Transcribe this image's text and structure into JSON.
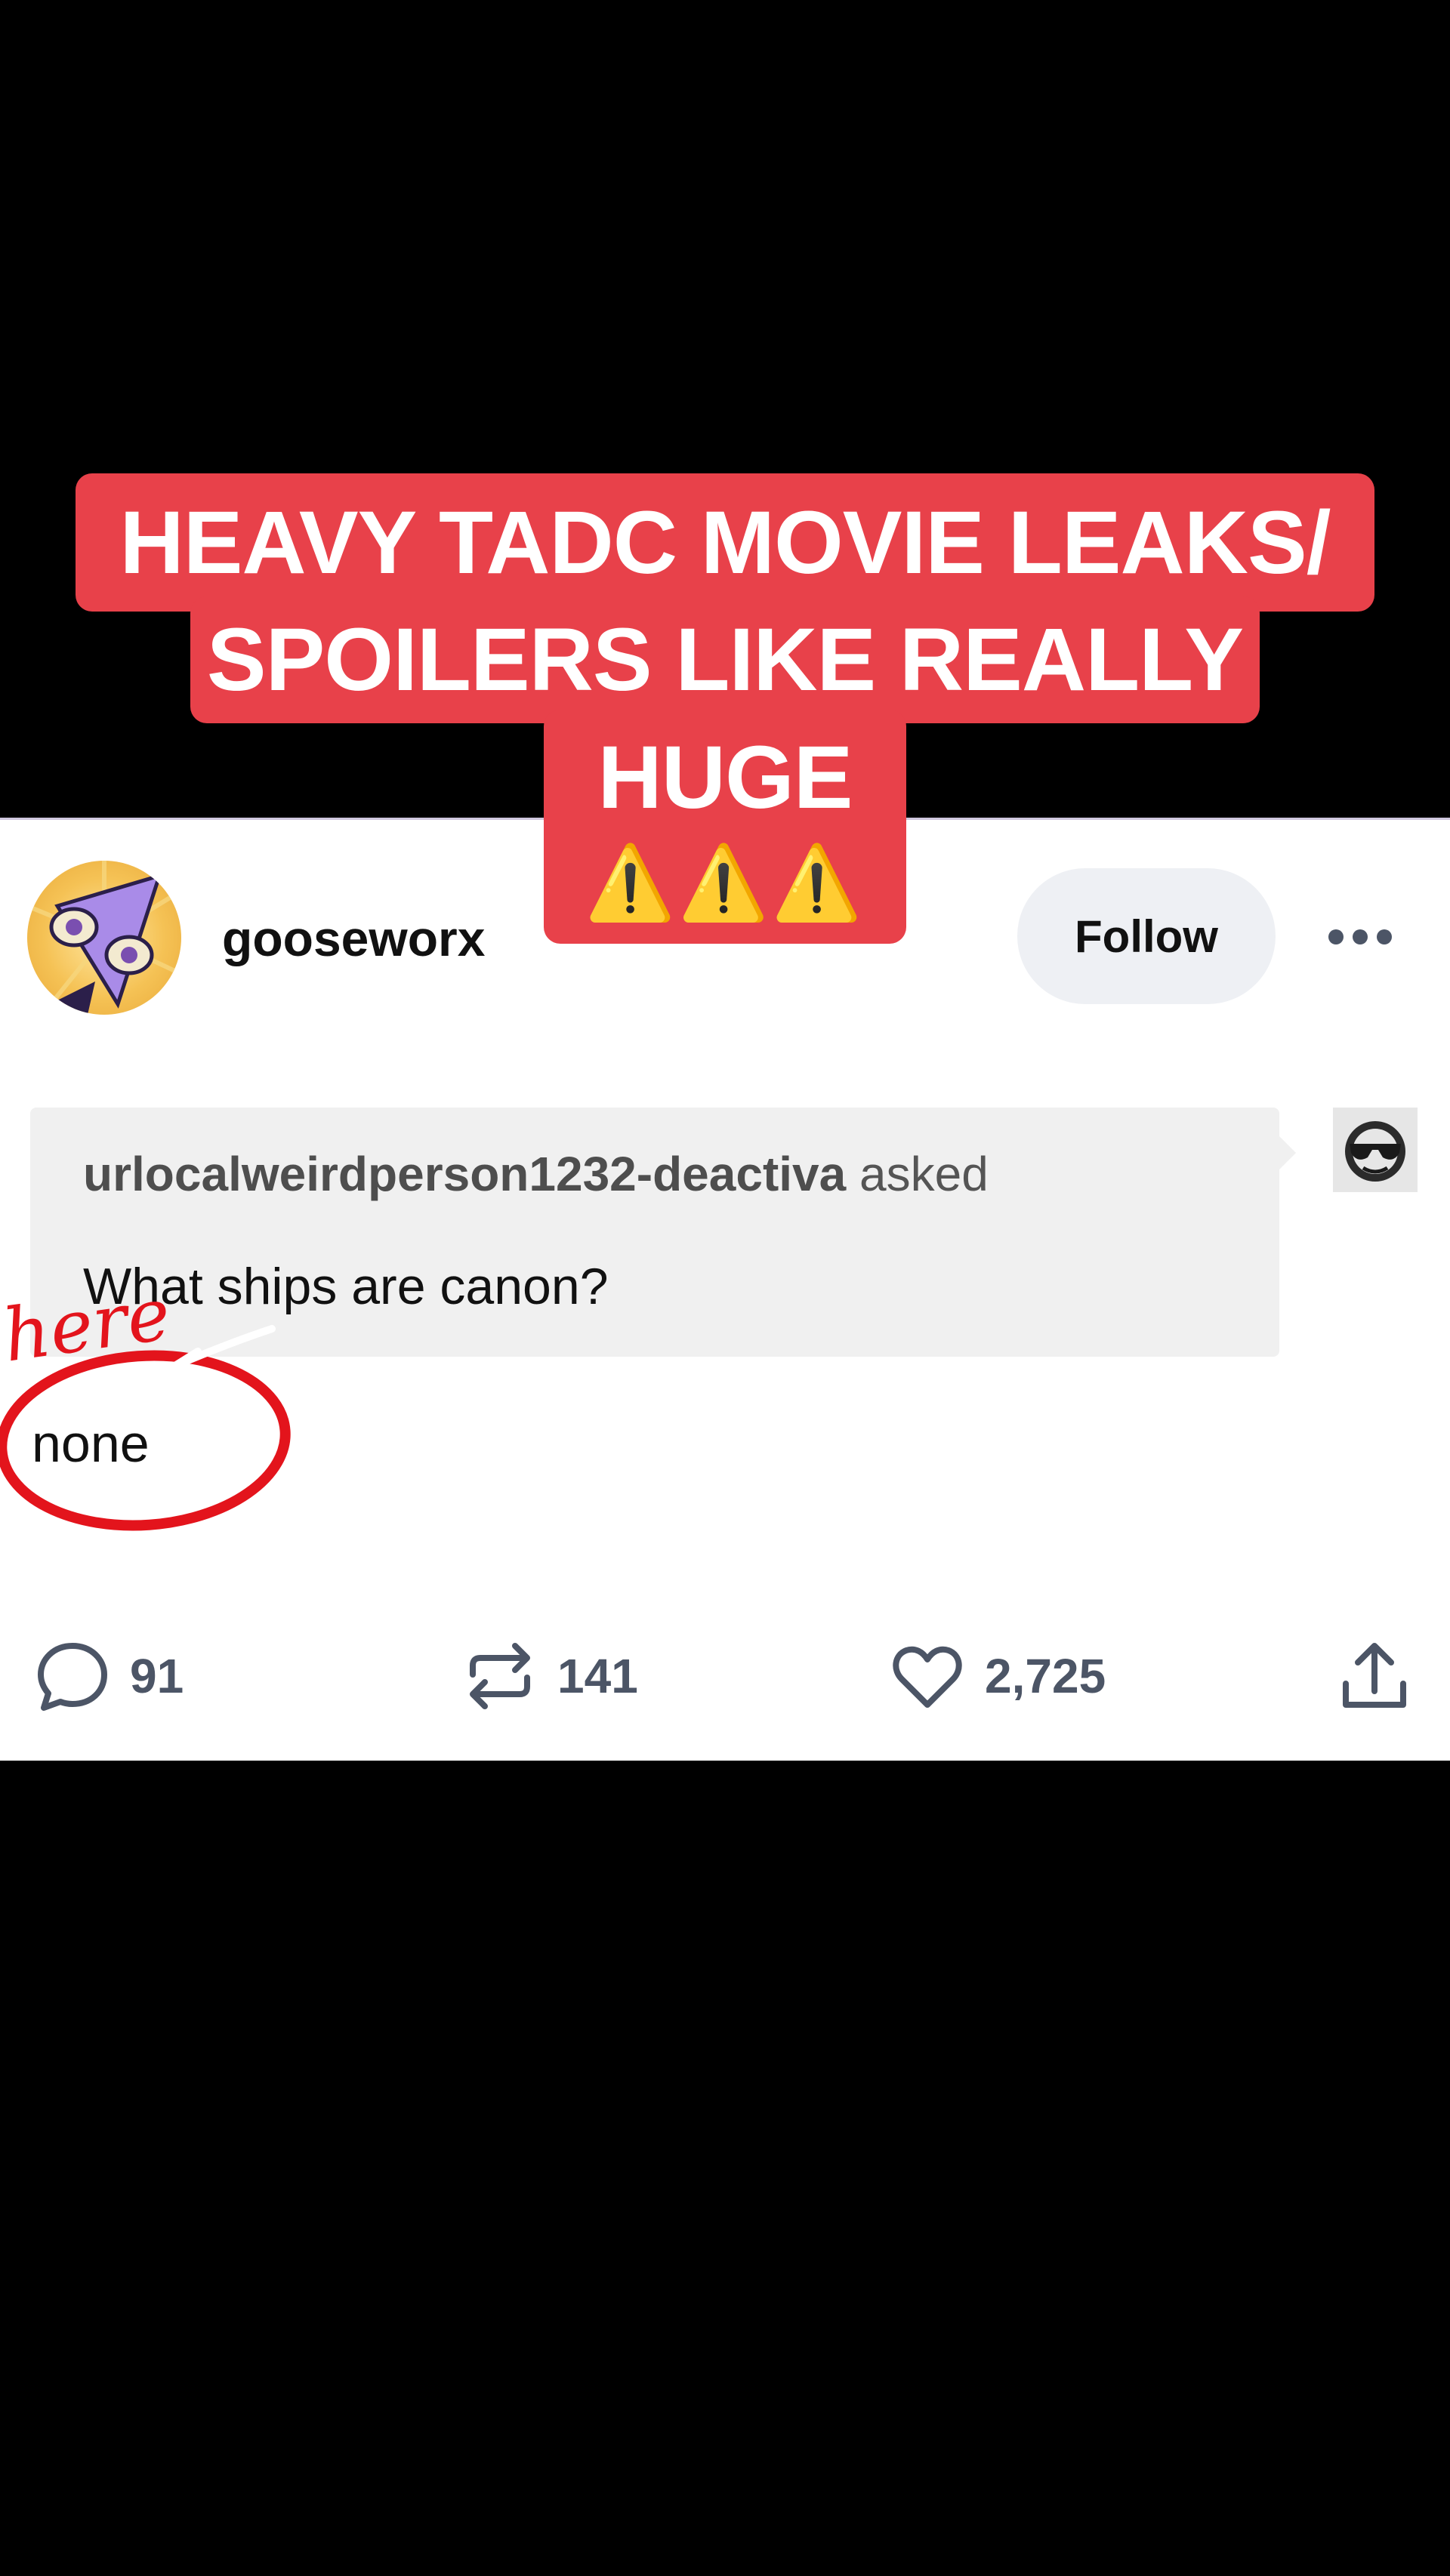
{
  "caption": {
    "line1": "HEAVY TADC MOVIE LEAKS/",
    "line2": "SPOILERS LIKE REALLY",
    "line3": "HUGE",
    "line4": "⚠️⚠️⚠️"
  },
  "post": {
    "username": "gooseworx",
    "follow_label": "Follow",
    "asker": "urlocalweirdperson1232-deactiva",
    "asked_word": " asked",
    "question": "What ships are canon?",
    "answer": "none",
    "annotation": "here"
  },
  "stats": {
    "comments": "91",
    "reblogs": "141",
    "likes": "2,725"
  },
  "icons": [
    "more-horizontal-icon",
    "comment-icon",
    "reblog-icon",
    "heart-icon",
    "share-icon",
    "sunglasses-icon"
  ],
  "colors": {
    "caption_bg": "#e8414a",
    "annotation_red": "#e3141c",
    "icon_gray": "#4c5566"
  }
}
